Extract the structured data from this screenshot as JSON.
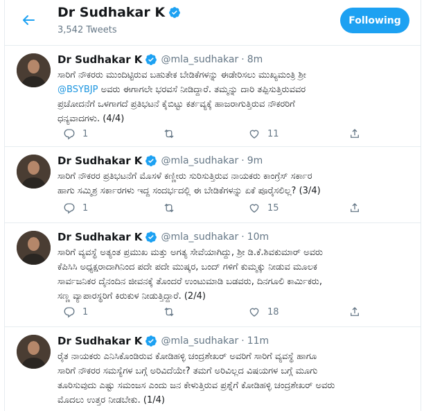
{
  "header": {
    "name": "Dr Sudhakar K",
    "tweet_count": "3,542 Tweets",
    "follow_label": "Following"
  },
  "colors": {
    "accent": "#1da1f2",
    "mention": "#1b95e0",
    "muted": "#657786"
  },
  "tweets": [
    {
      "name": "Dr Sudhakar K",
      "handle": "@mla_sudhakar",
      "time": "8m",
      "lines": [
        "ಸಾರಿಗೆ ನೌಕರರು ಮುಂದಿಟ್ಟಿರುವ ಬಹುತೇಕ ಬೇಡಿಕೆಗಳನ್ನು ಈಡೇರಿಸಲು ಮುಖ್ಯಮಂತ್ರಿ ಶ್ರೀ",
        "ಅವರು ಈಗಾಗಲೇ ಭರವಸೆ ನೀಡಿದ್ದಾರೆ. ತಮ್ಮನ್ನು ದಾರಿ ತಪ್ಪಿಸುತ್ತಿರುವವರ",
        "ಪ್ರಚೋದನೆಗೆ ಒಳಗಾಗದೆ ಪ್ರತಿಭಟನೆ ಕೈಬಿಟ್ಟು ಕರ್ತವ್ಯಕ್ಕೆ ಹಾಜರಾಗುತ್ತಿರುವ ನೌಕರರಿಗೆ",
        "ಧನ್ಯವಾದಗಳು. (4/4)"
      ],
      "mention": "@BSYBJP",
      "replies": "1",
      "retweets": "",
      "likes": "11"
    },
    {
      "name": "Dr Sudhakar K",
      "handle": "@mla_sudhakar",
      "time": "9m",
      "lines": [
        "ಸಾರಿಗೆ ನೌಕರರ ಪ್ರತಿಭಟನೆಗೆ ಮೊಸಳೆ ಕಣ್ಣೀರು ಸುರಿಸುತ್ತಿರುವ  ನಾಯಕರು ಕಾಂಗ್ರೆಸ್ ಸರ್ಕಾರ",
        "ಹಾಗು ಸಮ್ಮಿಶ್ರ ಸರ್ಕಾರಗಳು ಇದ್ದ ಸಂದರ್ಭದಲ್ಲಿ ಈ ಬೇಡಿಕೆಗಳನ್ನು ಏಕೆ ಪೂರೈಸಲಿಲ್ಲ? (3/4)"
      ],
      "replies": "1",
      "retweets": "",
      "likes": "15"
    },
    {
      "name": "Dr Sudhakar K",
      "handle": "@mla_sudhakar",
      "time": "10m",
      "lines": [
        "ಸಾರಿಗೆ ವ್ಯವಸ್ಥೆ ಅತ್ಯಂತ ಪ್ರಮುಖ ಮತ್ತು ಅಗತ್ಯ ಸೇವೆಯಾಗಿದ್ದು, ಶ್ರೀ ಡಿ.ಕೆ.ಶಿವಕುಮಾರ್ ಅವರು",
        "ಕೆಪಿಸಿಸಿ ಅಧ್ಯಕ್ಷರಾದಾಗಿನಿಂದ ಪದೇ ಪದೇ ಮುಷ್ಕರ, ಬಂದ್ ಗಳಿಗೆ ಕುಮ್ಮಕ್ಕು ನೀಡುವ ಮೂಲಕ",
        "ಸಾರ್ವಜನಿಕರ ದೈನಂದಿನ ಜೀವನಕ್ಕೆ ತೊಂದರೆ ಉಂಟುಮಾಡಿ ಬಡವರು, ದಿನಗೂಲಿ ಕಾರ್ಮಿಕರು,",
        "ಸಣ್ಣ ವ್ಯಾಪಾರಸ್ಥರಿಗೆ ಕಿರುಕುಳ ನೀಡುತ್ತಿದ್ದಾರೆ. (2/4)"
      ],
      "replies": "1",
      "retweets": "",
      "likes": "18"
    },
    {
      "name": "Dr Sudhakar K",
      "handle": "@mla_sudhakar",
      "time": "11m",
      "lines": [
        "ರೈತ ನಾಯಕರು ಎನಿಸಿಕೊಂಡಿರುವ ಕೋಡಿಹಳ್ಳಿ ಚಂದ್ರಶೇಖರ್ ಅವರಿಗೆ ಸಾರಿಗೆ ವ್ಯವಸ್ಥೆ ಹಾಗೂ",
        "ಸಾರಿಗೆ ನೌಕರರ ಸಮಸ್ಯೆಗಳ ಬಗ್ಗೆ ಅರಿವಿದೆಯೇ? ತಮಗೆ ಅರಿವಿಲ್ಲದ ವಿಷಯಗಳ ಬಗ್ಗೆ ಮೂಗು",
        "ತೂರಿಸುವುದು ಎಷ್ಟು ಸಮಂಜಸ ಎಂದು ಜನ ಕೇಳುತ್ತಿರುವ ಪ್ರಶ್ನೆಗೆ ಕೋಡಿಹಳ್ಳಿ ಚಂದ್ರಶೇಖರ್ ಅವರು",
        "ಮೊದಲು ಉತ್ತರ ನೀಡಬೇಕು. (1/4)"
      ]
    }
  ]
}
